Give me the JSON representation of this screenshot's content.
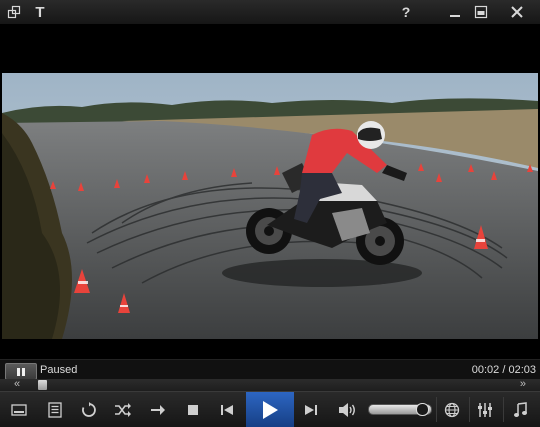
{
  "titlebar": {
    "icons": [
      "playlist-toggle-icon",
      "subtitle-t-icon",
      "help-icon",
      "minimize-icon",
      "restore-icon",
      "close-icon"
    ],
    "subtitle_letter": "T",
    "help_symbol": "?"
  },
  "status": {
    "state": "Paused",
    "time": "00:02 / 02:03"
  },
  "seek": {
    "progress": 0.016
  },
  "volume": {
    "level": 0.93
  },
  "controls": {
    "buttons": [
      "fullscreen",
      "playlist",
      "repeat",
      "shuffle",
      "next-file",
      "stop",
      "previous",
      "play",
      "next",
      "volume",
      "volume-slider",
      "globe",
      "equalizer",
      "music"
    ]
  },
  "colors": {
    "accent": "#1f4f9e",
    "play_glyph": "#ffffff",
    "panel": "#1e1e1e"
  }
}
